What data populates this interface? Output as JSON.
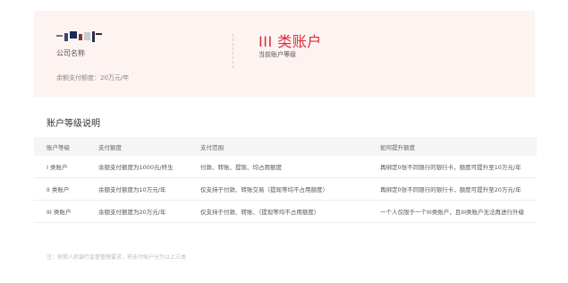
{
  "summary": {
    "company_label": "公司名称",
    "quota_line": "余额支付额度：20万元/年",
    "level_name": "III 类账户",
    "level_label": "当前账户等级"
  },
  "section_title": "账户等级说明",
  "table": {
    "headers": [
      "账户等级",
      "支付额度",
      "支付范围",
      "如何提升额度"
    ],
    "rows": [
      [
        "I 类账户",
        "余额支付额度为1000元/终生",
        "付款、转账、提现、均占用额度",
        "再绑定0张不同银行的银行卡，额度可提升至10万元/年"
      ],
      [
        "II 类账户",
        "余额支付额度为10万元/年",
        "仅支持于付款、转账交易（提现等均不占用额度）",
        "再绑定0张不同银行的银行卡，额度可提升至20万元/年"
      ],
      [
        "III 类账户",
        "余额支付额度为20万元/年",
        "仅支持于付款、转账、（提现等均不占用额度）",
        "一个人仅限于一个III类账户，且III类账户无法再进行升级"
      ]
    ]
  },
  "note": "注：依照人民银行监督管理要求，将支付账户分为以上三类",
  "colors": {
    "accent": "#d8303a",
    "summary_bg": "#fdf3f1",
    "header_bg": "#f5f5f5"
  },
  "icons": {
    "logo": "company-logo-image"
  }
}
